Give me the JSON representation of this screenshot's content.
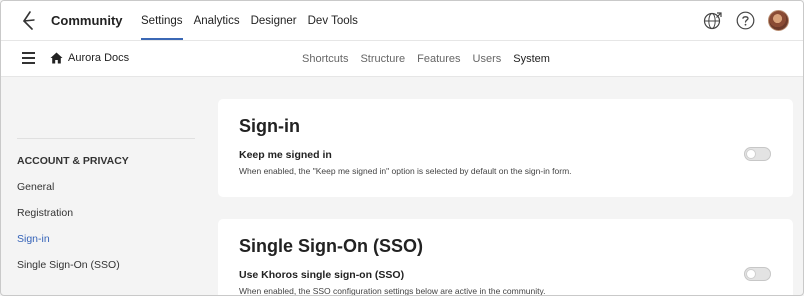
{
  "topbar": {
    "brand": "Community",
    "nav": [
      {
        "label": "Settings",
        "active": true
      },
      {
        "label": "Analytics",
        "active": false
      },
      {
        "label": "Designer",
        "active": false
      },
      {
        "label": "Dev Tools",
        "active": false
      }
    ],
    "icons": [
      "globe-icon",
      "help-icon",
      "avatar"
    ]
  },
  "subbar": {
    "breadcrumb": "Aurora Docs",
    "tabs": [
      {
        "label": "Shortcuts",
        "active": false
      },
      {
        "label": "Structure",
        "active": false
      },
      {
        "label": "Features",
        "active": false
      },
      {
        "label": "Users",
        "active": false
      },
      {
        "label": "System",
        "active": true
      }
    ]
  },
  "sidebar": {
    "section_title": "ACCOUNT & PRIVACY",
    "items": [
      {
        "label": "General",
        "active": false
      },
      {
        "label": "Registration",
        "active": false
      },
      {
        "label": "Sign-in",
        "active": true
      },
      {
        "label": "Single Sign-On (SSO)",
        "active": false
      }
    ]
  },
  "sections": [
    {
      "title": "Sign-in",
      "setting_label": "Keep me signed in",
      "setting_desc": "When enabled, the \"Keep me signed in\" option is selected by default on the sign-in form.",
      "enabled": false
    },
    {
      "title": "Single Sign-On (SSO)",
      "setting_label": "Use Khoros single sign-on (SSO)",
      "setting_desc": "When enabled, the SSO configuration settings below are active in the community.",
      "enabled": false
    }
  ],
  "colors": {
    "accent": "#3b68b5",
    "link_active": "#3563b8",
    "background": "#f4f4f4"
  }
}
